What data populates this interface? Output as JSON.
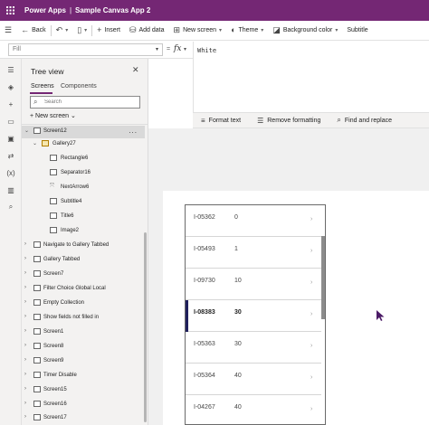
{
  "titlebar": {
    "app_name": "Power Apps",
    "separator": "|",
    "app_title": "Sample Canvas App 2",
    "waffle_icon": "waffle-icon",
    "bg_color": "#742774"
  },
  "commandbar": {
    "back": "Back",
    "insert": "Insert",
    "add_data": "Add data",
    "new_screen": "New screen",
    "theme": "Theme",
    "background_color": "Background color",
    "cut_off_label": "Subtitle"
  },
  "formulabar": {
    "property": "Fill",
    "equals": "=",
    "fx": "fx",
    "formula": "White",
    "tools": {
      "format_text": "Format text",
      "remove_formatting": "Remove formatting",
      "find_replace": "Find and replace"
    }
  },
  "treeview": {
    "title": "Tree view",
    "tabs": [
      "Screens",
      "Components"
    ],
    "search_placeholder": "Search",
    "new_screen": "New screen",
    "more": "...",
    "items": [
      {
        "label": "Screen12",
        "level": 0,
        "expanded": true,
        "selected": true
      },
      {
        "label": "Gallery27",
        "level": 1,
        "expanded": true
      },
      {
        "label": "Rectangle6",
        "level": 2
      },
      {
        "label": "Separator16",
        "level": 2
      },
      {
        "label": "NextArrow6",
        "level": 2
      },
      {
        "label": "Subtitle4",
        "level": 2
      },
      {
        "label": "Title6",
        "level": 2
      },
      {
        "label": "Image2",
        "level": 2
      },
      {
        "label": "Navigate to Gallery Tabbed",
        "level": 0
      },
      {
        "label": "Gallery Tabbed",
        "level": 0
      },
      {
        "label": "Screen7",
        "level": 0
      },
      {
        "label": "Filter Choice Global Local",
        "level": 0
      },
      {
        "label": "Empty Collection",
        "level": 0
      },
      {
        "label": "Show fields not filled in",
        "level": 0
      },
      {
        "label": "Screen1",
        "level": 0
      },
      {
        "label": "Screen8",
        "level": 0
      },
      {
        "label": "Screen9",
        "level": 0
      },
      {
        "label": "Timer Disable",
        "level": 0
      },
      {
        "label": "Screen15",
        "level": 0
      },
      {
        "label": "Screen16",
        "level": 0
      },
      {
        "label": "Screen17",
        "level": 0
      }
    ]
  },
  "gallery": {
    "items": [
      {
        "title": "I-05362",
        "subtitle": "0"
      },
      {
        "title": "I-05493",
        "subtitle": "1"
      },
      {
        "title": "I-09730",
        "subtitle": "10"
      },
      {
        "title": "I-08383",
        "subtitle": "30",
        "selected": true
      },
      {
        "title": "I-05363",
        "subtitle": "30"
      },
      {
        "title": "I-05364",
        "subtitle": "40"
      },
      {
        "title": "I-04267",
        "subtitle": "40"
      }
    ]
  }
}
